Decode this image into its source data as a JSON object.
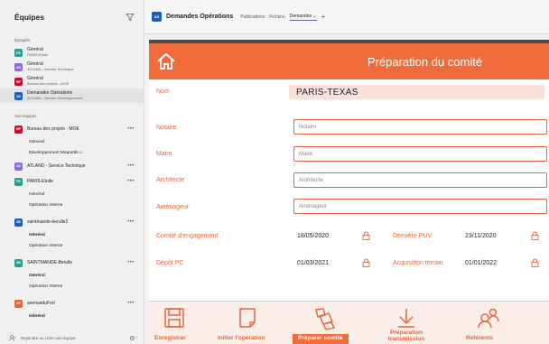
{
  "sidebar": {
    "title": "Équipes",
    "pinned_section": "Épinglés",
    "pinned": [
      {
        "name": "Général",
        "sub": "PARIS-Etoile",
        "color": "#2a9d8f",
        "abbr": "PE"
      },
      {
        "name": "Général",
        "sub": "ATLAND - Service Technique",
        "color": "#8e6cd8",
        "abbr": "AS"
      },
      {
        "name": "Général",
        "sub": "Bureau des projets - MOE",
        "color": "#c8102e",
        "abbr": "BP"
      },
      {
        "name": "Demandes Opérations",
        "sub": "ATLAND - Service Développement",
        "color": "#1a5fb4",
        "abbr": "AS"
      }
    ],
    "teams_section": "Vos équipes",
    "teams": [
      {
        "name": "Bureau des projets - MOE",
        "color": "#c8102e",
        "abbr": "BP",
        "channels": [
          {
            "label": "Général",
            "bold": false
          },
          {
            "label": "Développement Maquette  ⌂",
            "bold": false
          }
        ]
      },
      {
        "name": "ATLAND - Service Technique",
        "color": "#8e6cd8",
        "abbr": "AS",
        "channels": []
      },
      {
        "name": "PARIS-Etoile",
        "color": "#2a9d8f",
        "abbr": "PE",
        "channels": [
          {
            "label": "Général",
            "bold": false
          },
          {
            "label": "Opération Interne",
            "bold": false
          }
        ]
      },
      {
        "name": "saintmande-berulle2",
        "color": "#1a5fb4",
        "abbr": "SB",
        "channels": [
          {
            "label": "Général",
            "bold": true
          },
          {
            "label": "Opération Interne",
            "bold": false
          }
        ]
      },
      {
        "name": "SAINTMANDE-Berulle",
        "color": "#2a9d8f",
        "abbr": "SB",
        "channels": [
          {
            "label": "Général",
            "bold": true
          },
          {
            "label": "Opération Interne",
            "bold": false
          }
        ]
      },
      {
        "name": "avenueduFort",
        "color": "#e8643b",
        "abbr": "AF",
        "channels": [
          {
            "label": "Général",
            "bold": true
          }
        ]
      }
    ],
    "footer_text": "Rejoindre ou créer une équipe"
  },
  "topbar": {
    "avatar_abbr": "AS",
    "title": "Demandes Opérations",
    "tabs": [
      "Publications",
      "Fichiers",
      "Demandes ⌄"
    ],
    "plus": "+"
  },
  "app": {
    "header_title": "Préparation du comité",
    "nom_label": "Nom",
    "nom_value": "PARIS-TEXAS",
    "fields": [
      {
        "label": "Notaire",
        "placeholder": "Notaire"
      },
      {
        "label": "Maire",
        "placeholder": "Maire"
      },
      {
        "label": "Architecte",
        "placeholder": "Architecte"
      },
      {
        "label": "Aménageur",
        "placeholder": "Aménageur"
      }
    ],
    "dates": [
      {
        "label": "Comité d'engagement",
        "value": "18/05/2020"
      },
      {
        "label": "Dernière PUV",
        "value": "23/11/2020"
      },
      {
        "label": "Dépôt PC",
        "value": "01/03/2021"
      },
      {
        "label": "Acquisition terrain",
        "value": "01/01/2022"
      }
    ],
    "actions": [
      {
        "label": "Enregistrer",
        "icon": "save-icon"
      },
      {
        "label": "Initier l'opération",
        "icon": "document-icon"
      },
      {
        "label": "Préparer comité",
        "icon": "tickets-icon"
      },
      {
        "label": "Préparation transmission",
        "icon": "download-arrow-icon"
      },
      {
        "label": "Référents",
        "icon": "people-icon"
      }
    ],
    "accent": "#f16c3a"
  }
}
